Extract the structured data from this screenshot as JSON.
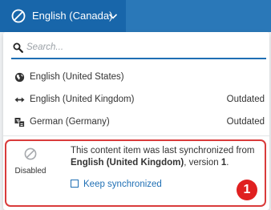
{
  "header": {
    "language_label": "English (Canada)",
    "button_color": "#1866aa",
    "bar_color": "#2a78b8"
  },
  "search": {
    "placeholder": "Search...",
    "value": ""
  },
  "languages": [
    {
      "label": "English (United States)",
      "status": "",
      "icon": "globe-icon"
    },
    {
      "label": "English (United Kingdom)",
      "status": "Outdated",
      "icon": "double-arrow-icon"
    },
    {
      "label": "German (Germany)",
      "status": "Outdated",
      "icon": "translate-icon"
    }
  ],
  "sync": {
    "state_label": "Disabled",
    "message_prefix": "This content item was last synchronized from",
    "source_language": "English (United Kingdom)",
    "message_middle": ", version ",
    "version": "1",
    "message_suffix": ".",
    "keep_label": "Keep synchronized",
    "highlight_color": "#d93b3b"
  },
  "annotation": {
    "number": "1"
  }
}
